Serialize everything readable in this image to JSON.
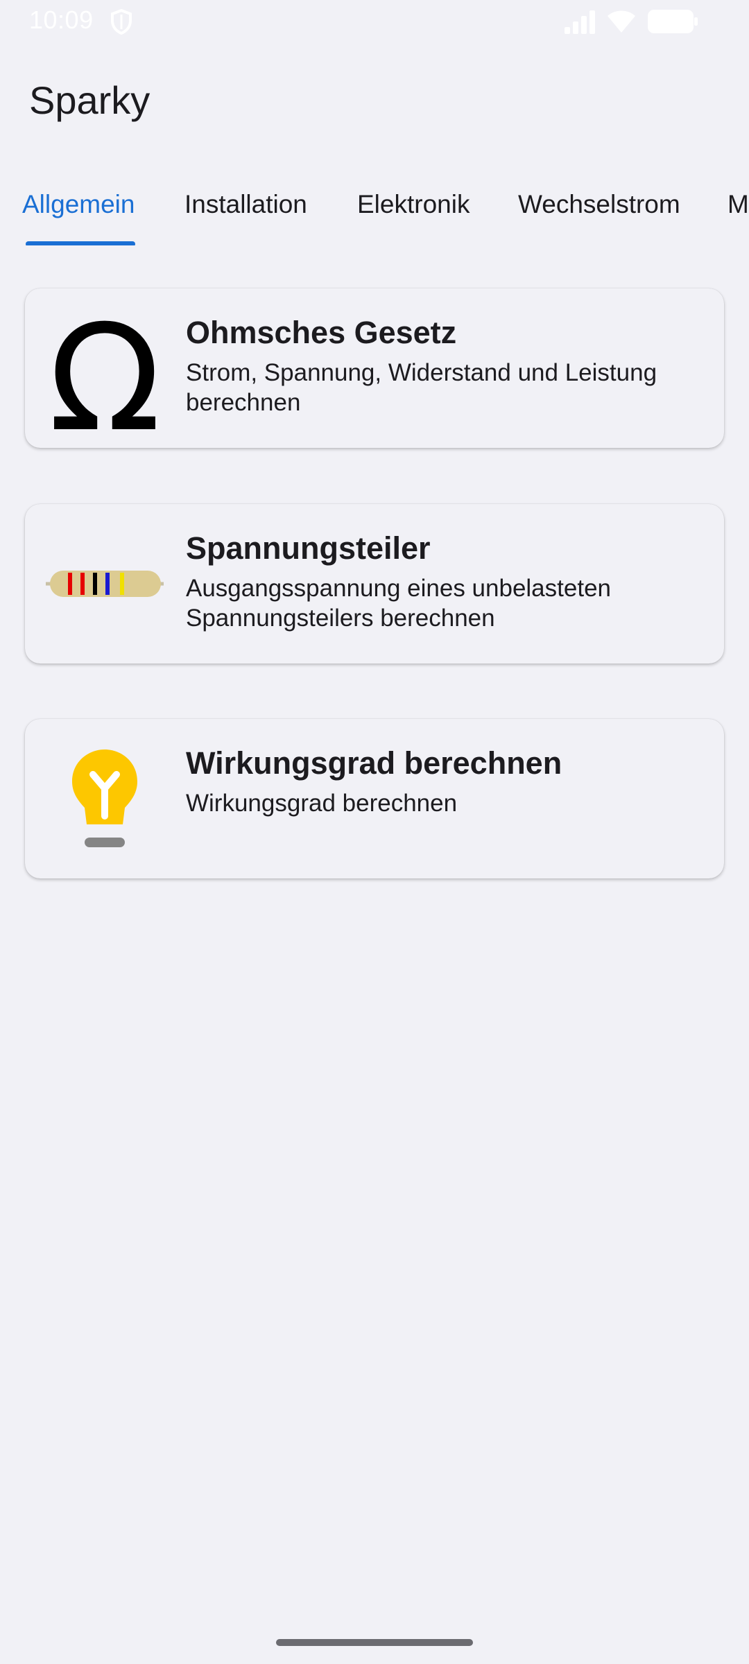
{
  "status_bar": {
    "time": "10:09",
    "icons": [
      "shield-icon",
      "signal-icon",
      "wifi-icon",
      "battery-icon"
    ]
  },
  "app": {
    "title": "Sparky"
  },
  "tabs": [
    {
      "label": "Allgemein",
      "active": true
    },
    {
      "label": "Installation",
      "active": false
    },
    {
      "label": "Elektronik",
      "active": false
    },
    {
      "label": "Wechselstrom",
      "active": false
    },
    {
      "label": "M",
      "active": false
    }
  ],
  "cards": [
    {
      "icon": "omega-icon",
      "icon_glyph": "Ω",
      "title": "Ohmsches Gesetz",
      "description": "Strom, Spannung, Widerstand und Leistung berechnen"
    },
    {
      "icon": "resistor-icon",
      "title": "Spannungsteiler",
      "description": "Ausgangsspannung eines unbelasteten Spannungsteilers berechnen"
    },
    {
      "icon": "lightbulb-icon",
      "title": "Wirkungsgrad berechnen",
      "description": "Wirkungsgrad berechnen"
    }
  ],
  "colors": {
    "accent": "#1a6fd4",
    "background": "#f1f1f6",
    "bulb": "#fdc700",
    "resistor_body": "#dccb92"
  }
}
